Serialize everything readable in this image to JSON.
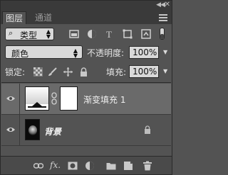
{
  "window": {
    "collapse_glyph": "◀◀",
    "close_glyph": "✕"
  },
  "tabs": [
    {
      "label": "图层",
      "active": true
    },
    {
      "label": "通道",
      "active": false
    }
  ],
  "filter": {
    "kind_label": "类型",
    "search_glyph": "⌕",
    "icons": [
      "pixel-layer-filter-icon",
      "adjustment-layer-filter-icon",
      "type-layer-filter-icon",
      "shape-layer-filter-icon",
      "smart-object-filter-icon"
    ],
    "type_icon_glyph": "T"
  },
  "blend": {
    "mode": "颜色",
    "opacity_label": "不透明度:",
    "opacity_value": "100%"
  },
  "lock": {
    "label": "锁定:",
    "icons": [
      "lock-transparency-icon",
      "lock-image-pixels-icon",
      "lock-position-icon",
      "lock-all-icon"
    ],
    "fill_label": "填充:",
    "fill_value": "100%"
  },
  "layers": [
    {
      "name": "渐变填充 1",
      "selected": true,
      "visible": true,
      "type": "gradient-fill"
    },
    {
      "name": "背景",
      "selected": false,
      "visible": true,
      "locked": true,
      "type": "background"
    }
  ],
  "bottom_toolbar": {
    "fx_label": "fx.",
    "icons": [
      "link-layers-icon",
      "layer-style-icon",
      "add-mask-icon",
      "adjustment-layer-icon",
      "new-group-icon",
      "new-layer-icon",
      "delete-layer-icon"
    ]
  },
  "colors": {
    "panel_bg": "#535353",
    "selected_layer_bg": "#6a6a6a",
    "field_bg": "#d9d9d9"
  }
}
